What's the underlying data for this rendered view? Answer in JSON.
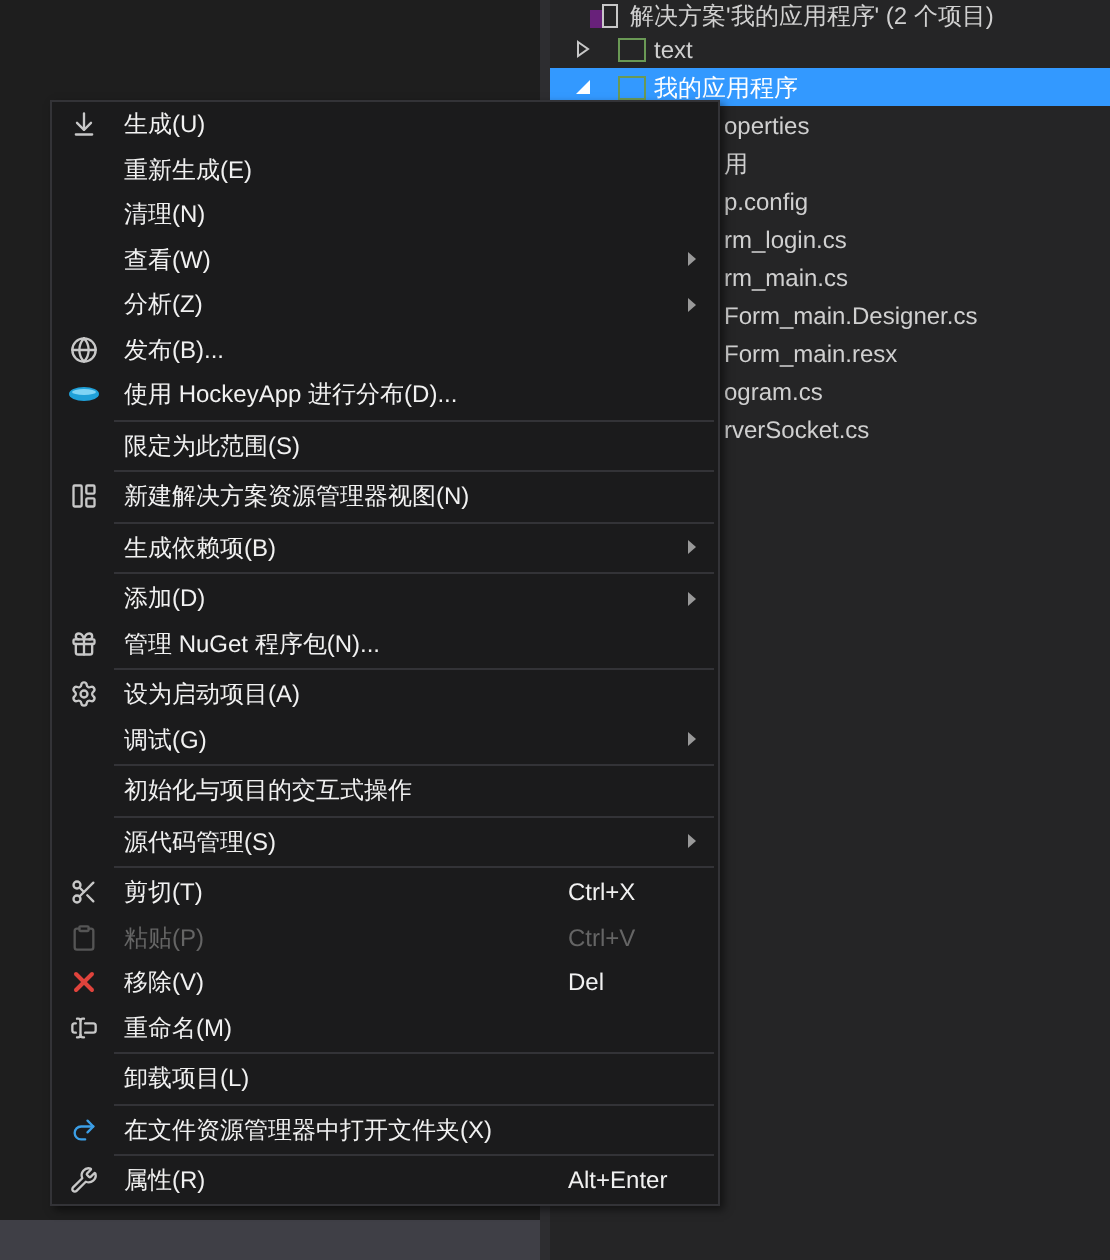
{
  "solution_explorer": {
    "items": [
      {
        "kind": "solution",
        "label": "解决方案'我的应用程序' (2 个项目)",
        "selected": false
      },
      {
        "kind": "project",
        "label": "text",
        "selected": false,
        "expanded": false
      },
      {
        "kind": "project",
        "label": "我的应用程序",
        "selected": true,
        "expanded": true,
        "children": [
          {
            "kind": "file",
            "label": "operties"
          },
          {
            "kind": "file",
            "label": "用"
          },
          {
            "kind": "file",
            "label": "p.config"
          },
          {
            "kind": "file",
            "label": "rm_login.cs"
          },
          {
            "kind": "file",
            "label": "rm_main.cs",
            "children": [
              {
                "kind": "file",
                "label": "Form_main.Designer.cs"
              },
              {
                "kind": "file",
                "label": "Form_main.resx"
              }
            ]
          },
          {
            "kind": "file",
            "label": "ogram.cs"
          },
          {
            "kind": "file",
            "label": "rverSocket.cs"
          }
        ]
      }
    ]
  },
  "context_menu": {
    "items": [
      {
        "kind": "item",
        "label": "生成(U)",
        "disabled": false
      },
      {
        "kind": "item",
        "label": "重新生成(E)",
        "disabled": false
      },
      {
        "kind": "item",
        "label": "清理(N)",
        "disabled": false
      },
      {
        "kind": "item",
        "label": "查看(W)",
        "disabled": false,
        "submenu": true
      },
      {
        "kind": "item",
        "label": "分析(Z)",
        "disabled": false,
        "submenu": true
      },
      {
        "kind": "item",
        "label": "发布(B)...",
        "disabled": false
      },
      {
        "kind": "item",
        "label": "使用 HockeyApp 进行分布(D)...",
        "disabled": false
      },
      {
        "kind": "separator"
      },
      {
        "kind": "item",
        "label": "限定为此范围(S)",
        "disabled": false
      },
      {
        "kind": "separator"
      },
      {
        "kind": "item",
        "label": "新建解决方案资源管理器视图(N)",
        "disabled": false
      },
      {
        "kind": "separator"
      },
      {
        "kind": "item",
        "label": "生成依赖项(B)",
        "disabled": false,
        "submenu": true
      },
      {
        "kind": "separator"
      },
      {
        "kind": "item",
        "label": "添加(D)",
        "disabled": false,
        "submenu": true
      },
      {
        "kind": "item",
        "label": "管理 NuGet 程序包(N)...",
        "disabled": false
      },
      {
        "kind": "separator"
      },
      {
        "kind": "item",
        "label": "设为启动项目(A)",
        "disabled": false
      },
      {
        "kind": "item",
        "label": "调试(G)",
        "disabled": false,
        "submenu": true
      },
      {
        "kind": "separator"
      },
      {
        "kind": "item",
        "label": "初始化与项目的交互式操作",
        "disabled": false
      },
      {
        "kind": "separator"
      },
      {
        "kind": "item",
        "label": "源代码管理(S)",
        "disabled": false,
        "submenu": true
      },
      {
        "kind": "separator"
      },
      {
        "kind": "item",
        "label": "剪切(T)",
        "disabled": false,
        "shortcut": "Ctrl+X"
      },
      {
        "kind": "item",
        "label": "粘贴(P)",
        "disabled": true,
        "shortcut": "Ctrl+V"
      },
      {
        "kind": "item",
        "label": "移除(V)",
        "disabled": false,
        "shortcut": "Del"
      },
      {
        "kind": "item",
        "label": "重命名(M)",
        "disabled": false
      },
      {
        "kind": "separator"
      },
      {
        "kind": "item",
        "label": "卸载项目(L)",
        "disabled": false
      },
      {
        "kind": "separator"
      },
      {
        "kind": "item",
        "label": "在文件资源管理器中打开文件夹(X)",
        "disabled": false
      },
      {
        "kind": "separator"
      },
      {
        "kind": "item",
        "label": "属性(R)",
        "disabled": false,
        "shortcut": "Alt+Enter"
      }
    ]
  }
}
